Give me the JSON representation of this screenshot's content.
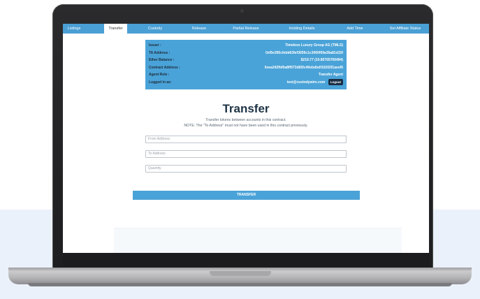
{
  "nav": {
    "tabs": [
      {
        "label": "Listings",
        "active": false
      },
      {
        "label": "Transfer",
        "active": true
      },
      {
        "label": "Custody",
        "active": false
      },
      {
        "label": "Release",
        "active": false
      },
      {
        "label": "Partial Release",
        "active": false
      },
      {
        "label": "Holding Details",
        "active": false
      },
      {
        "label": "Add Time",
        "active": false
      },
      {
        "label": "Set Affiliate Status",
        "active": false
      }
    ]
  },
  "info": {
    "issuer_label": "Issuer :",
    "issuer_value": "Timeless Luxury Group AG (TMLS)",
    "ta_label": "TA Address :",
    "ta_value": "0xf5e395cfebb63fef3059c1c3060f69a36a81d15f",
    "ether_label": "Ether Balance :",
    "ether_value": "$219.77 (10.85765766494)",
    "contract_label": "Contract Address :",
    "contract_value": "0xea242fbf0a8ff573d65fc49ebdbdf10202f1aeef6",
    "role_label": "Agent Role :",
    "role_value": "Transfer Agent",
    "logged_label": "Logged in as:",
    "logged_value": "test@custodywire.com",
    "logout_label": "Logout"
  },
  "main": {
    "title": "Transfer",
    "subtitle_line1": "Transfer tokens between accounts in this contract.",
    "subtitle_line2": "NOTE: The \"To Address\" must not have been used in this contract previously.",
    "from_placeholder": "From Address",
    "to_placeholder": "To Address",
    "quantity_placeholder": "Quantity",
    "submit_label": "TRANSFER"
  },
  "colors": {
    "accent": "#4aa3d8",
    "nav": "#4a9fd4",
    "dark": "#1a2e44"
  }
}
